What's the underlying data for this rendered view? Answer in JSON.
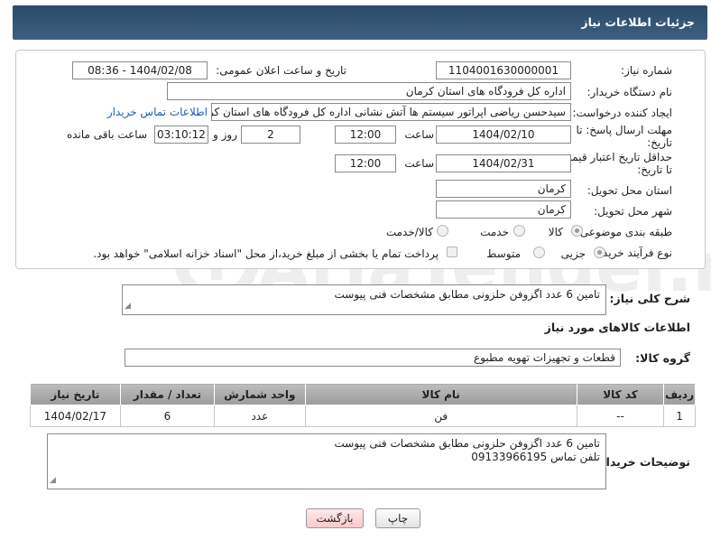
{
  "header": {
    "title": "جزئیات اطلاعات نیاز"
  },
  "form": {
    "need_number_label": "شماره نیاز:",
    "need_number": "1104001630000001",
    "announce_label": "تاریخ و ساعت اعلان عمومی:",
    "announce_value": "1404/02/08 - 08:36",
    "buyer_org_label": "نام دستگاه خریدار:",
    "buyer_org": "اداره کل فرودگاه های استان کرمان",
    "creator_label": "ایجاد کننده درخواست:",
    "creator": "سیدحسن ریاضی اپراتور سیستم ها آتش نشانی اداره کل فرودگاه های استان کرمان",
    "buyer_contact_link": "اطلاعات تماس خریدار",
    "deadline_label_1": "مهلت ارسال پاسخ: تا",
    "deadline_label_2": "تاریخ:",
    "deadline_date": "1404/02/10",
    "time_label": "ساعت",
    "deadline_time": "12:00",
    "days_value": "2",
    "days_label": "روز و",
    "remaining_time": "03:10:12",
    "remaining_label": "ساعت باقی مانده",
    "min_validity_label_1": "حداقل تاریخ اعتبار قیمت:",
    "min_validity_label_2": "تا تاریخ:",
    "validity_date": "1404/02/31",
    "validity_time": "12:00",
    "province_label": "استان محل تحویل:",
    "province": "کرمان",
    "city_label": "شهر محل تحویل:",
    "city": "کرمان",
    "category_label": "طبقه بندی موضوعی:",
    "category_options": [
      "کالا",
      "خدمت",
      "کالا/خدمت"
    ],
    "category_selected": "کالا",
    "process_label": "نوع فرآیند خرید :",
    "process_options": [
      "جزیی",
      "متوسط"
    ],
    "process_selected": "جزیی",
    "payment_note": "پرداخت تمام یا بخشی از مبلغ خرید،از محل \"اسناد خزانه اسلامی\" خواهد بود."
  },
  "summary": {
    "label": "شرح کلی نیاز:",
    "value": "تامین 6 عدد اگزوفن حلزونی مطابق مشخصات فنی پیوست"
  },
  "goods_section": {
    "title": "اطلاعات کالاهای مورد نیاز",
    "group_label": "گروه کالا:",
    "group_value": "قطعات و تجهیزات تهویه مطبوع"
  },
  "table": {
    "headers": [
      "ردیف",
      "کد کالا",
      "نام کالا",
      "واحد شمارش",
      "تعداد / مقدار",
      "تاریخ نیاز"
    ],
    "rows": [
      [
        "1",
        "--",
        "فن",
        "عدد",
        "6",
        "1404/02/17"
      ]
    ]
  },
  "buyer_notes": {
    "label": "توضیحات خریدار:",
    "line1": "تامین 6 عدد اگزوفن حلزونی مطابق مشخصات فنی پیوست",
    "line2": "تلفن تماس 09133966195"
  },
  "buttons": {
    "print": "چاپ",
    "back": "بازگشت"
  },
  "colors": {
    "header_bg": "#2b4b6b",
    "link": "#1a5fb4",
    "back_button": "#f7c9cb"
  }
}
